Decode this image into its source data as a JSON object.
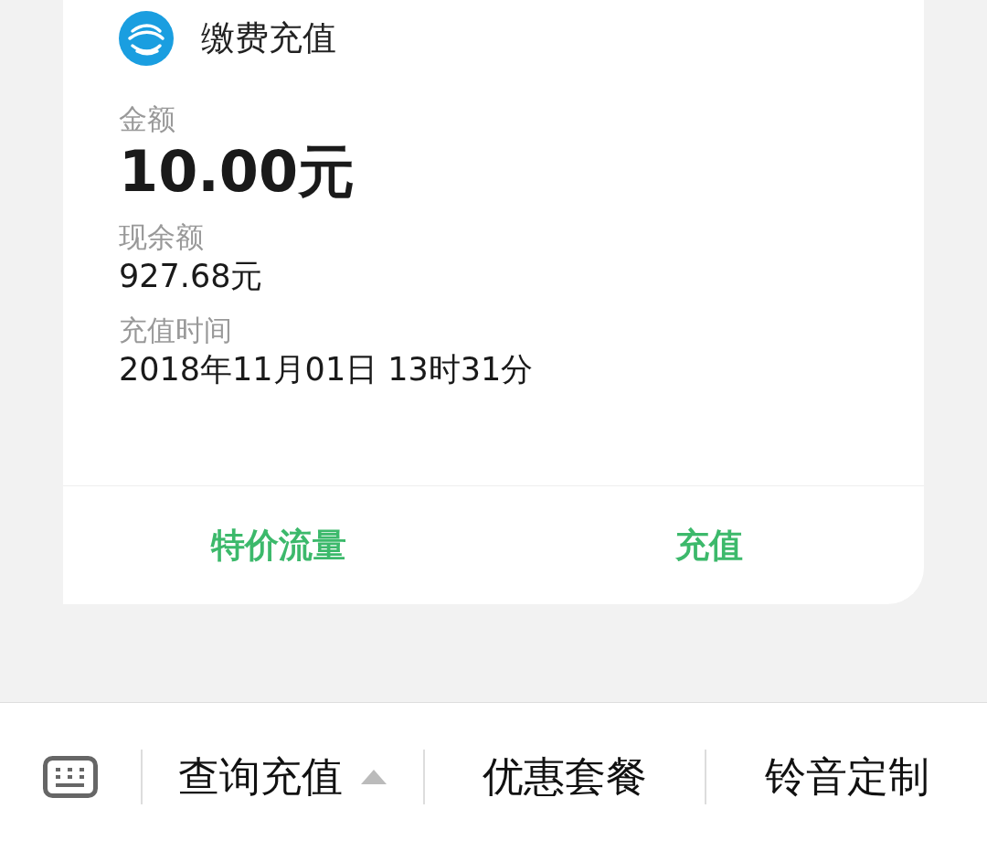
{
  "card": {
    "title": "缴费充值",
    "fields": [
      {
        "label": "金额",
        "value": "10.00元",
        "kind": "amount"
      },
      {
        "label": "现余额",
        "value": "927.68元",
        "kind": "plain"
      },
      {
        "label": "充值时间",
        "value": "2018年11月01日 13时31分",
        "kind": "plain"
      }
    ],
    "actions": [
      "特价流量",
      "充值"
    ]
  },
  "menu": [
    {
      "label": "查询充值",
      "submenu": true
    },
    {
      "label": "优惠套餐",
      "submenu": false
    },
    {
      "label": "铃音定制",
      "submenu": false
    }
  ]
}
